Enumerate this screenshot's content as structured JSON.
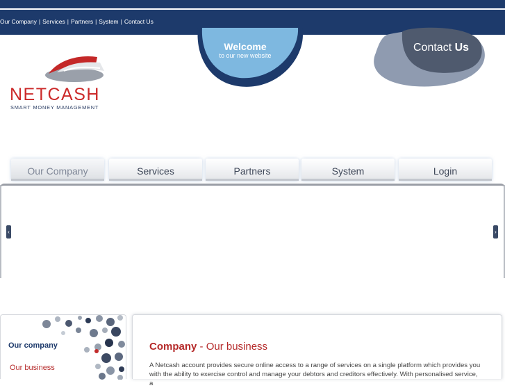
{
  "top_links": [
    "Our Company",
    "Services",
    "Partners",
    "System",
    "Contact Us"
  ],
  "top_link_separator": "|",
  "logo": {
    "name": "NETCASH",
    "tagline": "SMART MONEY MANAGEMENT"
  },
  "welcome": {
    "title": "Welcome",
    "subtitle": "to our new website"
  },
  "contact": {
    "word1": "Contact",
    "word2": "Us"
  },
  "main_nav": [
    {
      "label": "Our Company",
      "active": true
    },
    {
      "label": "Services",
      "active": false
    },
    {
      "label": "Partners",
      "active": false
    },
    {
      "label": "System",
      "active": false
    },
    {
      "label": "Login",
      "active": false
    }
  ],
  "slider": {
    "prev_glyph": "‹",
    "next_glyph": "›"
  },
  "sidebar": {
    "title": "Our company",
    "links": [
      "Our business"
    ]
  },
  "content": {
    "title_bold": "Company",
    "title_dash": " - ",
    "title_rest": "Our business",
    "body": "A Netcash account provides secure online access to a range of services on a single platform which provides you with the ability to exercise control and manage your debtors and creditors effectively. With personalised service, a"
  },
  "colors": {
    "brand_navy": "#1d3a6b",
    "brand_red": "#cc2a2a",
    "welcome_blue": "#7eb8e0",
    "contact_gray": "#8f9bb0"
  }
}
